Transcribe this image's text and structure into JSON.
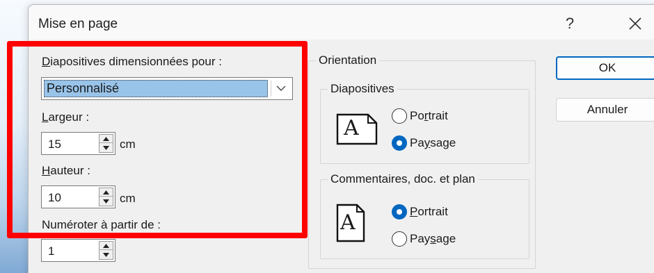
{
  "dialog": {
    "title": "Mise en page",
    "help_label": "?"
  },
  "slide_size": {
    "label_access": "D",
    "label_rest": "iapositives dimensionnées pour :",
    "selected": "Personnalisé"
  },
  "width": {
    "label_access": "L",
    "label_rest": "argeur :",
    "value": "15",
    "unit": "cm"
  },
  "height": {
    "label_access": "H",
    "label_rest": "auteur :",
    "value": "10",
    "unit": "cm"
  },
  "numbering": {
    "label": "Numéroter à partir de :",
    "value": "1"
  },
  "orientation": {
    "title": "Orientation",
    "slides": {
      "title": "Diapositives",
      "page_letter": "A",
      "portrait_pre": "Po",
      "portrait_access": "r",
      "portrait_post": "trait",
      "landscape_pre": "Pa",
      "landscape_access": "y",
      "landscape_post": "sage",
      "selected": "Paysage"
    },
    "notes": {
      "title": "Commentaires, doc. et plan",
      "page_letter": "A",
      "portrait_access": "P",
      "portrait_post": "ortrait",
      "landscape_pre": "Pay",
      "landscape_access": "s",
      "landscape_post": "age",
      "selected": "Portrait"
    }
  },
  "buttons": {
    "ok": "OK",
    "cancel": "Annuler"
  },
  "colors": {
    "accent": "#0067c0",
    "highlight_frame": "#ff0000",
    "selection": "#99c4ea"
  }
}
